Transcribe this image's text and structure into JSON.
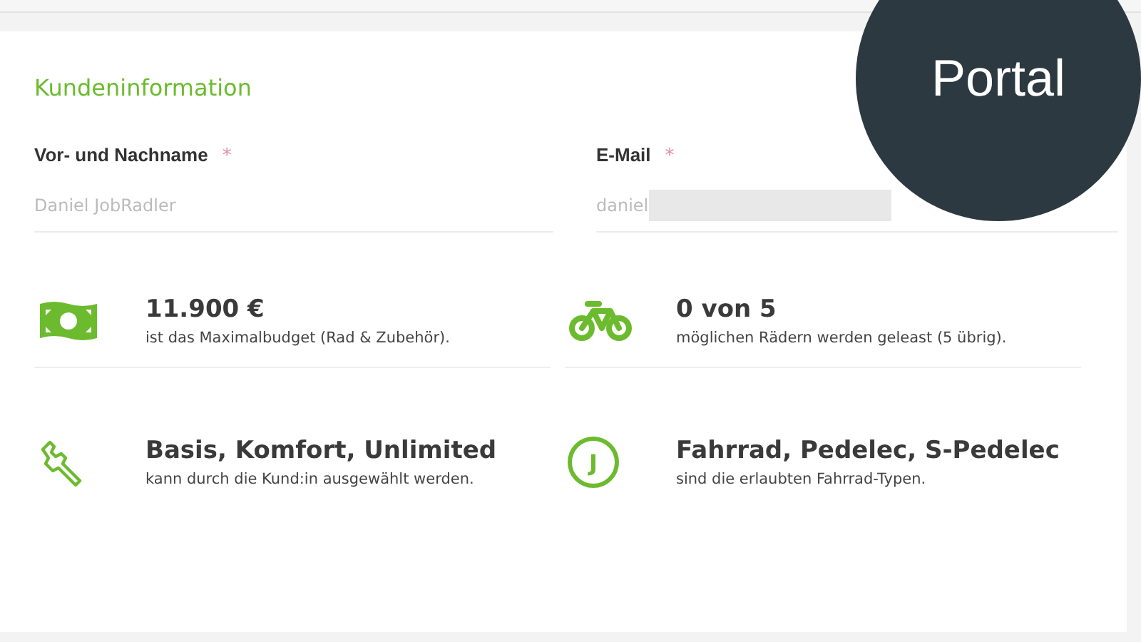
{
  "badge": {
    "label": "Portal"
  },
  "section": {
    "title": "Kundeninformation"
  },
  "fields": [
    {
      "label": "Vor- und Nachname",
      "required_mark": "*",
      "value": "Daniel JobRadler"
    },
    {
      "label": "E-Mail",
      "required_mark": "*",
      "value": "daniel",
      "redacted": true
    }
  ],
  "stats": [
    {
      "kind": "money",
      "value": "11.900 €",
      "description": "ist das Maximalbudget (Rad & Zubehör)."
    },
    {
      "kind": "bike",
      "value": "0 von 5",
      "description": "möglichen Rädern werden geleast (5 übrig)."
    },
    {
      "kind": "wrench",
      "value": "Basis, Komfort, Unlimited",
      "description": "kann durch die Kund:in ausgewählt werden."
    },
    {
      "kind": "letter",
      "letter": "J",
      "value": "Fahrrad, Pedelec, S-Pedelec",
      "description": "sind die erlaubten Fahrrad-Typen."
    }
  ]
}
